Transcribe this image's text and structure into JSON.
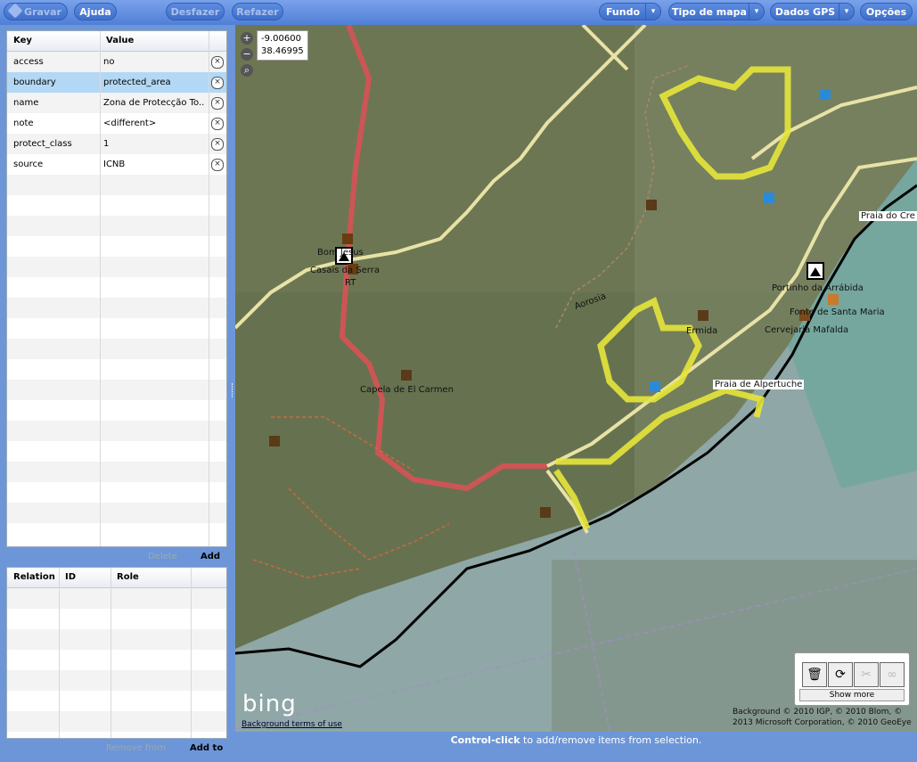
{
  "toolbar": {
    "save": "Gravar",
    "help": "Ajuda",
    "undo": "Desfazer",
    "redo": "Refazer",
    "background": "Fundo",
    "map_type": "Tipo de mapa",
    "gps": "Dados GPS",
    "options": "Opções",
    "dropdown_arrow": "▾"
  },
  "tags": {
    "col_key": "Key",
    "col_value": "Value",
    "rows": [
      {
        "key": "access",
        "value": "no"
      },
      {
        "key": "boundary",
        "value": "protected_area"
      },
      {
        "key": "name",
        "value": "Zona de Protecção To..."
      },
      {
        "key": "note",
        "value": "<different>"
      },
      {
        "key": "protect_class",
        "value": "1"
      },
      {
        "key": "source",
        "value": "ICNB"
      }
    ],
    "selected_row": 1,
    "delete_label": "Delete",
    "add_label": "Add"
  },
  "relations": {
    "col_relation": "Relation",
    "col_id": "ID",
    "col_role": "Role",
    "remove_label": "Remove from",
    "add_label": "Add to"
  },
  "map": {
    "zoom_in": "+",
    "zoom_out": "−",
    "lon": "-9.00600",
    "lat": "38.46995",
    "labels": {
      "bom_jesus": "Bom Jesus",
      "casais": "Casais da Serra",
      "rt": "RT",
      "capela": "Capela de El Carmen",
      "ermida": "Ermida",
      "portinho": "Portinho da Arrábida",
      "fonte": "Fonte de Santa Maria",
      "cervejaria": "Cervejaria Mafalda",
      "alpertuche": "Praia de Alpertuche",
      "praia_creiro": "Praia do Cre",
      "road_vertical": "Aorosia"
    },
    "bing_logo": "bing",
    "bg_terms": "Background terms of use",
    "attribution": "Background © 2010 IGP, © 2010 Blom, © 2013 Microsoft Corporation, © 2010 GeoEye",
    "show_more": "Show more"
  },
  "status": {
    "bold": "Control-click",
    "rest": " to add/remove items from selection."
  }
}
